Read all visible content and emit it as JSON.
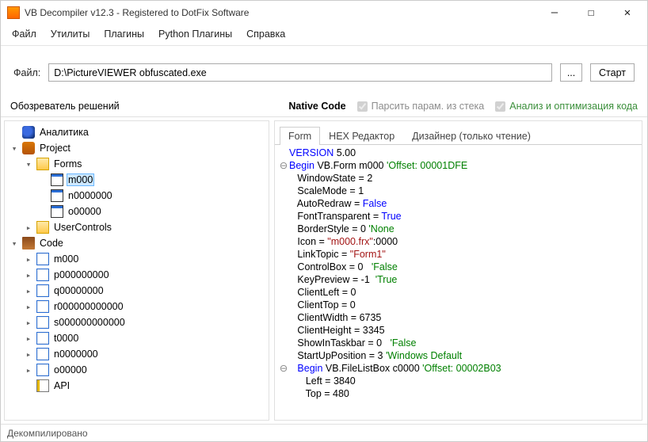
{
  "title": "VB Decompiler v12.3 - Registered to DotFix Software",
  "menu": [
    "Файл",
    "Утилиты",
    "Плагины",
    "Python Плагины",
    "Справка"
  ],
  "filebar": {
    "label": "Файл:",
    "path": "D:\\PictureVIEWER obfuscated.exe",
    "browse": "...",
    "start": "Старт"
  },
  "toolbar": {
    "explorer": "Обозреватель решений",
    "native": "Native Code",
    "parse": "Парсить парам. из стека",
    "opt": "Анализ и оптимизация кода"
  },
  "tree": {
    "analytics": "Аналитика",
    "project": "Project",
    "forms": "Forms",
    "forms_children": [
      "m000",
      "n0000000",
      "o00000"
    ],
    "usercontrols": "UserControls",
    "code": "Code",
    "code_children": [
      "m000",
      "p000000000",
      "q00000000",
      "r000000000000",
      "s000000000000",
      "t0000",
      "n0000000",
      "o00000",
      "API"
    ]
  },
  "tabs": [
    "Form",
    "HEX Редактор",
    "Дизайнер (только чтение)"
  ],
  "code_lines": [
    {
      "gut": "",
      "html": "<span class='kw'>VERSION</span> <span class='num'>5.00</span>"
    },
    {
      "gut": "⊖",
      "html": "<span class='kw'>Begin</span> VB.Form m000 <span class='cmt'>'Offset: 00001DFE</span>"
    },
    {
      "gut": "",
      "html": "   WindowState = <span class='num'>2</span>"
    },
    {
      "gut": "",
      "html": "   ScaleMode = <span class='num'>1</span>"
    },
    {
      "gut": "",
      "html": "   AutoRedraw = <span class='kw'>False</span>"
    },
    {
      "gut": "",
      "html": "   FontTransparent = <span class='kw'>True</span>"
    },
    {
      "gut": "",
      "html": "   BorderStyle = <span class='num'>0</span> <span class='cmt'>'None</span>"
    },
    {
      "gut": "",
      "html": "   Icon = <span class='str'>\"m000.frx\"</span>:0000"
    },
    {
      "gut": "",
      "html": "   LinkTopic = <span class='str'>\"Form1\"</span>"
    },
    {
      "gut": "",
      "html": "   ControlBox = <span class='num'>0</span>   <span class='cmt'>'False</span>"
    },
    {
      "gut": "",
      "html": "   KeyPreview = <span class='num'>-1</span>  <span class='cmt'>'True</span>"
    },
    {
      "gut": "",
      "html": "   ClientLeft = <span class='num'>0</span>"
    },
    {
      "gut": "",
      "html": "   ClientTop = <span class='num'>0</span>"
    },
    {
      "gut": "",
      "html": "   ClientWidth = <span class='num'>6735</span>"
    },
    {
      "gut": "",
      "html": "   ClientHeight = <span class='num'>3345</span>"
    },
    {
      "gut": "",
      "html": "   ShowInTaskbar = <span class='num'>0</span>   <span class='cmt'>'False</span>"
    },
    {
      "gut": "",
      "html": "   StartUpPosition = <span class='num'>3</span> <span class='cmt'>'Windows Default</span>"
    },
    {
      "gut": "⊖",
      "html": "   <span class='kw'>Begin</span> VB.FileListBox c0000 <span class='cmt'>'Offset: 00002B03</span>"
    },
    {
      "gut": "",
      "html": "      Left = <span class='num'>3840</span>"
    },
    {
      "gut": "",
      "html": "      Top = <span class='num'>480</span>"
    }
  ],
  "status": "Декомпилировано"
}
